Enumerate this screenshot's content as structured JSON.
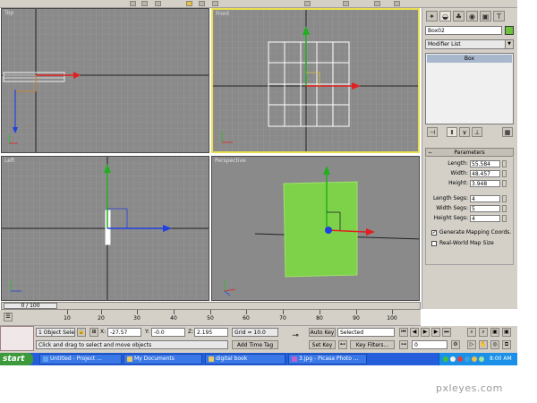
{
  "viewports": {
    "top": {
      "label": "Top"
    },
    "front": {
      "label": "Front"
    },
    "left": {
      "label": "Left"
    },
    "perspective": {
      "label": "Perspective"
    }
  },
  "command_panel": {
    "object_name": "Box02",
    "object_color": "#6dc33c",
    "modifier_list": "Modifier List",
    "stack_item": "Box",
    "parameters": {
      "title": "Parameters",
      "length_label": "Length:",
      "length_value": "55.584",
      "width_label": "Width:",
      "width_value": "48.457",
      "height_label": "Height:",
      "height_value": "3.948",
      "length_segs_label": "Length Segs:",
      "length_segs_value": "4",
      "width_segs_label": "Width Segs:",
      "width_segs_value": "5",
      "height_segs_label": "Height Segs:",
      "height_segs_value": "4",
      "gen_mapping_label": "Generate Mapping Coords.",
      "gen_mapping_checked": "✓",
      "real_world_label": "Real-World Map Size"
    }
  },
  "timeline": {
    "slider_label": "0 / 100",
    "ticks": [
      "10",
      "20",
      "30",
      "40",
      "50",
      "60",
      "70",
      "80",
      "90",
      "100"
    ]
  },
  "status": {
    "selection": "1 Object Sele",
    "x_label": "X:",
    "x_value": "-27.57",
    "y_label": "Y:",
    "y_value": "-0.0",
    "z_label": "Z:",
    "z_value": "2.195",
    "grid": "Grid = 10.0",
    "auto_key": "Auto Key",
    "selected": "Selected",
    "set_key": "Set Key",
    "key_filters": "Key Filters...",
    "prompt": "Click and drag to select and move objects",
    "add_time_tag": "Add Time Tag",
    "frame_value": "0"
  },
  "taskbar": {
    "start": "start",
    "tasks": [
      "Untitled",
      "- Project ...",
      "My Documents",
      "digital book",
      "3.jpg - Picasa Photo ..."
    ],
    "clock": "8:00 AM"
  },
  "watermark": "pxleyes.com",
  "colors": {
    "axis_x": "#e02020",
    "axis_y": "#20c020",
    "axis_z": "#2040e0",
    "box_green": "#7ed24a",
    "active_border": "#e8e050"
  }
}
